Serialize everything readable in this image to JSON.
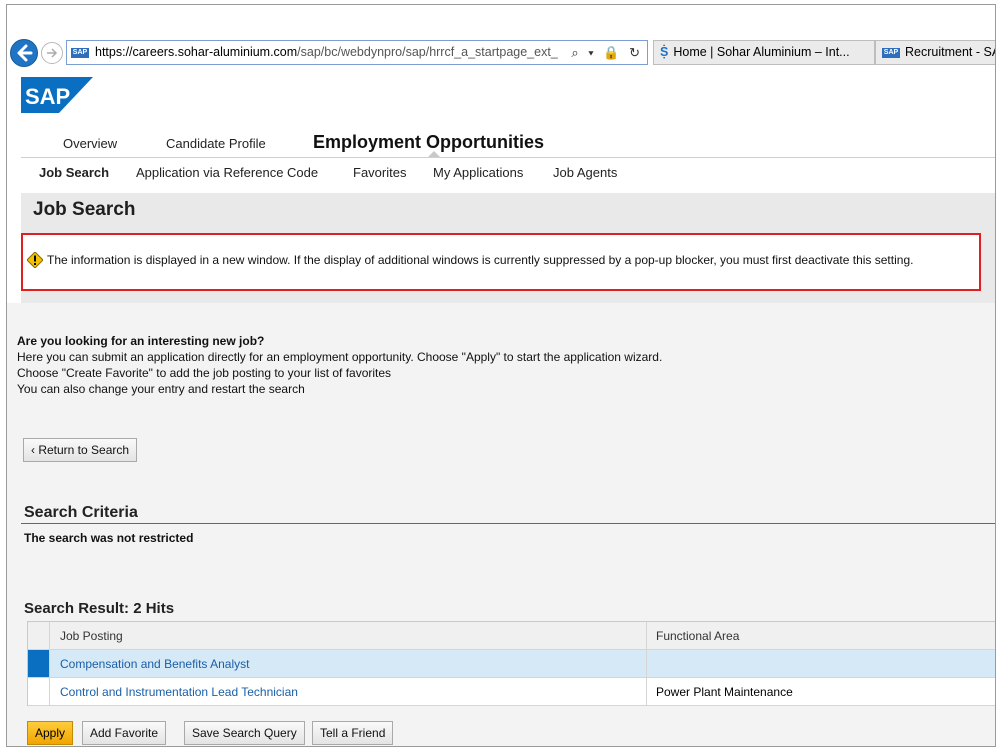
{
  "browser": {
    "url_protocol": "https://careers.",
    "url_domain": "sohar-aluminium.com",
    "url_path": "/sap/bc/webdynpro/sap/hrrcf_a_startpage_ext_",
    "url_icons": "⌕ ▾ 🔒 ↻",
    "tabs": [
      {
        "label": "Home | Sohar Aluminium – Int...",
        "icon": "sohar-icon"
      },
      {
        "label": "Recruitment - SA",
        "icon": "sap-icon"
      }
    ]
  },
  "logo": {
    "text": "SAP"
  },
  "top_nav": {
    "overview": "Overview",
    "candidate_profile": "Candidate Profile",
    "employment_opportunities": "Employment Opportunities"
  },
  "sub_nav": {
    "items": [
      "Job Search",
      "Application via Reference Code",
      "Favorites",
      "My Applications",
      "Job Agents"
    ]
  },
  "page": {
    "title": "Job Search",
    "message": "The information is displayed in a new window. If the display of additional windows is currently suppressed by a pop-up blocker, you must first deactivate this setting."
  },
  "intro": {
    "question": "Are you looking for an interesting new job?",
    "line1": "Here you can submit an application directly for an employment opportunity. Choose \"Apply\" to start the application wizard.",
    "line2": "Choose \"Create Favorite\" to add the job posting to your list of favorites",
    "line3": "You can also change your entry and restart the search"
  },
  "return_button": "‹ Return to Search",
  "search_criteria": {
    "title": "Search Criteria",
    "text": "The search was not restricted"
  },
  "search_result": {
    "title": "Search Result: 2  Hits",
    "columns": [
      "Job Posting",
      "Functional Area"
    ],
    "rows": [
      {
        "job": "Compensation and Benefits Analyst",
        "area": ""
      },
      {
        "job": "Control and Instrumentation Lead Technician",
        "area": "Power Plant Maintenance"
      }
    ]
  },
  "actions": {
    "apply": "Apply",
    "add_favorite": "Add Favorite",
    "save_search": "Save Search Query",
    "tell_friend": "Tell a Friend"
  },
  "colors": {
    "accent_blue": "#0a6ec1",
    "apply_yellow": "#f0a500",
    "message_border": "#e02020"
  }
}
